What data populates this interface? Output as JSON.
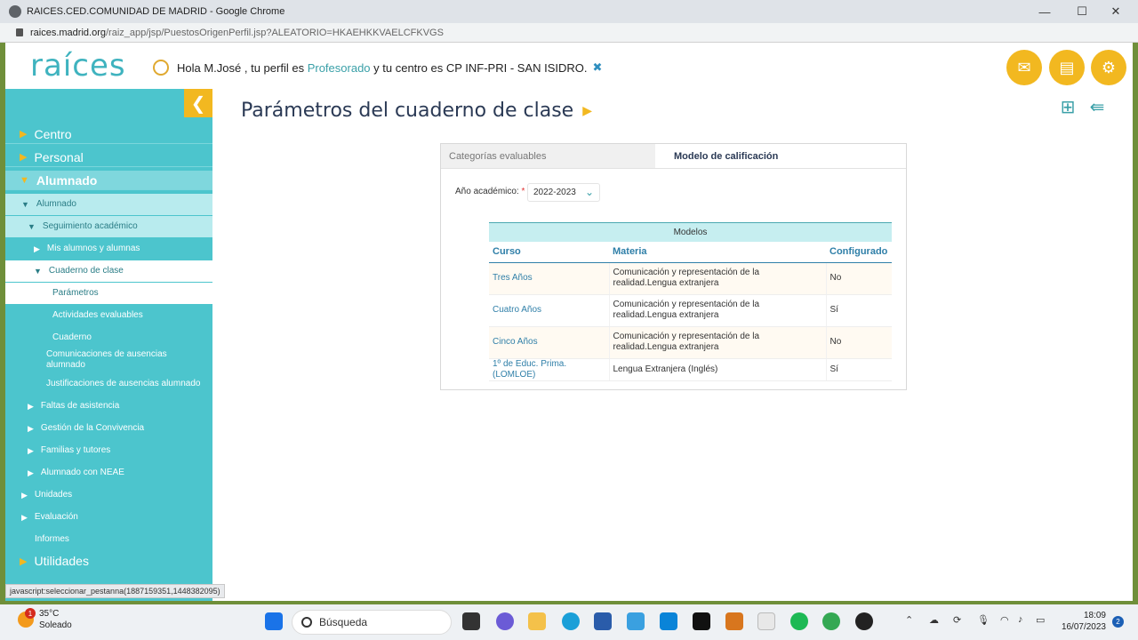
{
  "browser": {
    "tab_title": "RAICES.CED.COMUNIDAD DE MADRID - Google Chrome",
    "url_host": "raices.madrid.org",
    "url_path": "/raiz_app/jsp/PuestosOrigenPerfil.jsp?ALEATORIO=HKAEHKKVAELCFKVGS",
    "status_link": "javascript:seleccionar_pestanna(1887159351,1448382095)"
  },
  "header": {
    "logo": "raíces",
    "greeting_prefix": "Hola M.José",
    "greeting_mid": ", tu perfil es",
    "profile": "Profesorado",
    "greeting_mid2": "y tu centro es",
    "center": "CP INF-PRI - SAN ISIDRO.",
    "buttons": [
      "mail-icon",
      "folder-icon",
      "settings-icon"
    ]
  },
  "sidebar": {
    "items": [
      {
        "label": "Centro"
      },
      {
        "label": "Personal"
      },
      {
        "label": "Alumnado"
      },
      {
        "label": "Alumnado"
      },
      {
        "label": "Seguimiento académico"
      },
      {
        "label": "Mis alumnos y alumnas"
      },
      {
        "label": "Cuaderno de clase"
      },
      {
        "label": "Parámetros"
      },
      {
        "label": "Actividades evaluables"
      },
      {
        "label": "Cuaderno"
      },
      {
        "label": "Comunicaciones de ausencias alumnado"
      },
      {
        "label": "Justificaciones de ausencias alumnado"
      },
      {
        "label": "Faltas de asistencia"
      },
      {
        "label": "Gestión de la Convivencia"
      },
      {
        "label": "Familias y tutores"
      },
      {
        "label": "Alumnado con NEAE"
      },
      {
        "label": "Unidades"
      },
      {
        "label": "Evaluación"
      },
      {
        "label": "Informes"
      },
      {
        "label": "Utilidades"
      }
    ]
  },
  "main": {
    "title": "Parámetros del cuaderno de clase",
    "tabs": [
      {
        "label": "Categorías evaluables"
      },
      {
        "label": "Modelo de calificación"
      }
    ],
    "year_label": "Año académico:",
    "year_required": "*",
    "year_value": "2022-2023",
    "table": {
      "caption": "Modelos",
      "headers": [
        "Curso",
        "Materia",
        "Configurado"
      ],
      "rows": [
        {
          "curso": "Tres Años",
          "materia": "Comunicación y representación de la realidad.Lengua extranjera",
          "configurado": "No"
        },
        {
          "curso": "Cuatro Años",
          "materia": "Comunicación y representación de la realidad.Lengua extranjera",
          "configurado": "Sí"
        },
        {
          "curso": "Cinco Años",
          "materia": "Comunicación y representación de la realidad.Lengua extranjera",
          "configurado": "No"
        },
        {
          "curso": "1º de Educ. Prima. (LOMLOE)",
          "materia": "Lengua Extranjera (Inglés)",
          "configurado": "Sí"
        }
      ]
    }
  },
  "taskbar": {
    "temperature": "35°C",
    "weather": "Soleado",
    "weather_badge": "1",
    "search_placeholder": "Búsqueda",
    "time": "18:09",
    "date": "16/07/2023",
    "notifications": "2"
  },
  "colors": {
    "accent_teal": "#4cc5cd",
    "accent_yellow": "#f2b820",
    "title_navy": "#2b3a55"
  }
}
